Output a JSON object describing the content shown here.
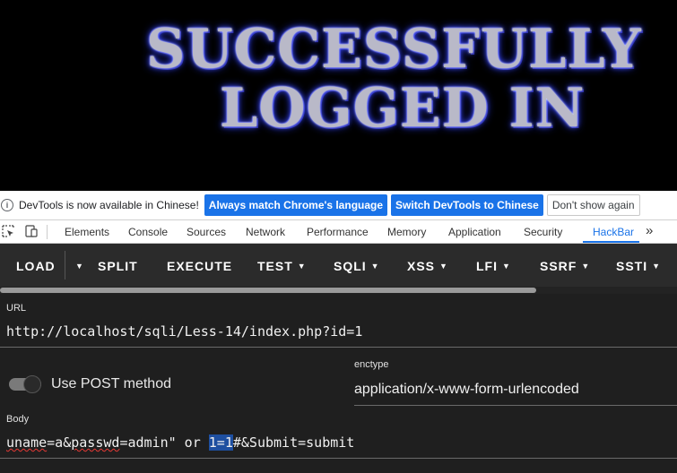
{
  "hero": {
    "line1": "SUCCESSFULLY",
    "line2": "LOGGED IN"
  },
  "infobar": {
    "message": "DevTools is now available in Chinese!",
    "btn_match": "Always match Chrome's language",
    "btn_switch": "Switch DevTools to Chinese",
    "btn_dismiss": "Don't show again",
    "accent": "#1a73e8"
  },
  "devtools": {
    "tabs": [
      "Elements",
      "Console",
      "Sources",
      "Network",
      "Performance",
      "Memory",
      "Application",
      "Security",
      "HackBar"
    ],
    "active_tab": "HackBar",
    "more": "»"
  },
  "hackbar": {
    "buttons": {
      "load": "LOAD",
      "split": "SPLIT",
      "execute": "EXECUTE",
      "test": "TEST",
      "sqli": "SQLI",
      "xss": "XSS",
      "lfi": "LFI",
      "ssrf": "SSRF",
      "ssti": "SSTI"
    },
    "url_label": "URL",
    "url_value": "http://localhost/sqli/Less-14/index.php?id=1",
    "post_toggle_label": "Use POST method",
    "post_enabled": false,
    "enctype_label": "enctype",
    "enctype_value": "application/x-www-form-urlencoded",
    "body_label": "Body",
    "body_value": {
      "part1": "uname",
      "part2": "=a&",
      "part3": "passwd",
      "part4": "=admin\" or ",
      "selected": "1=1",
      "part5": "#&Submit=submit"
    }
  }
}
